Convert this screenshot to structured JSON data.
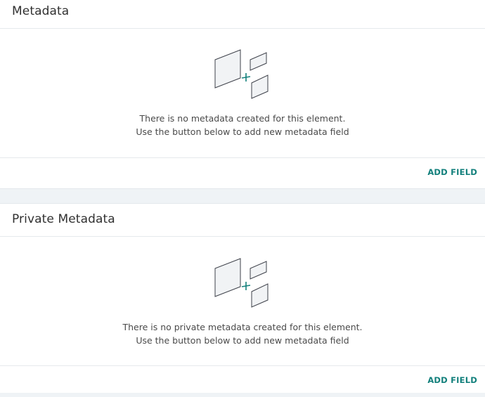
{
  "metadata": {
    "title": "Metadata",
    "empty_line1": "There is no metadata created for this element.",
    "empty_line2": "Use the button below to add new metadata field",
    "add_label": "ADD FIELD"
  },
  "private_metadata": {
    "title": "Private Metadata",
    "empty_line1": "There is no private metadata created for this element.",
    "empty_line2": "Use the button below to add new metadata field",
    "add_label": "ADD FIELD"
  },
  "colors": {
    "accent": "#13807c",
    "background": "#eff3f6",
    "card": "#ffffff"
  },
  "icons": {
    "empty_state": "add-metadata-illustration-icon"
  }
}
